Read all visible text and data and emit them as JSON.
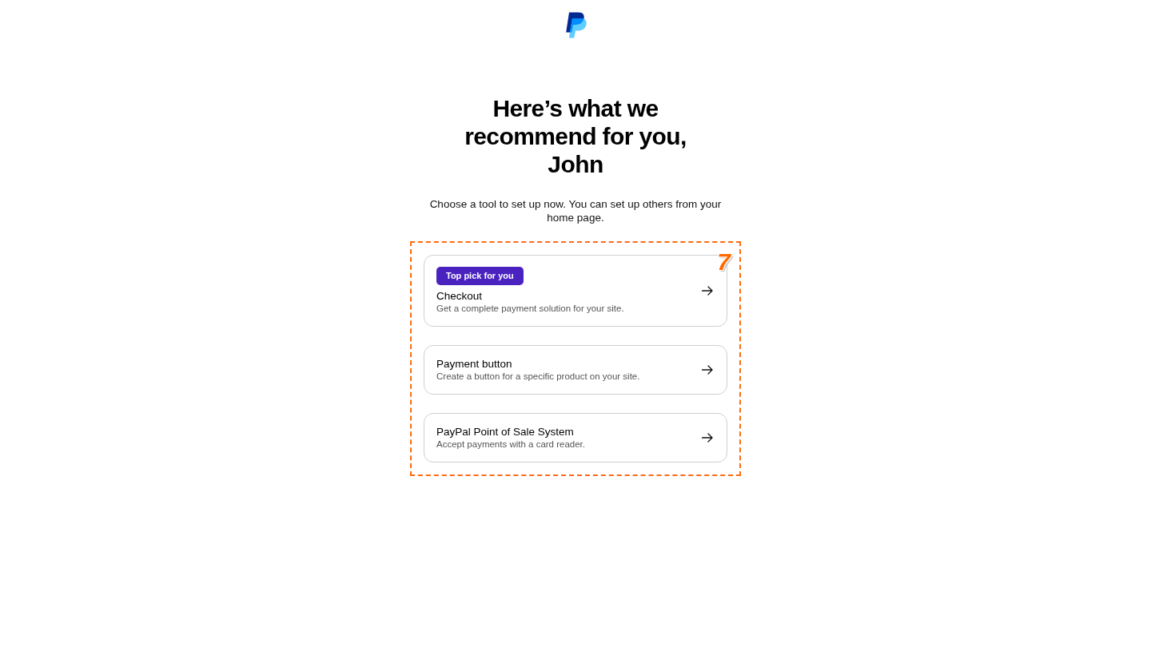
{
  "heading": "Here’s what we recommend for you, John",
  "subtitle": "Choose a tool to set up now. You can set up others from your home page.",
  "annotation": {
    "label": "7"
  },
  "tools": [
    {
      "badge": "Top pick for you",
      "title": "Checkout",
      "description": "Get a complete payment solution for your site."
    },
    {
      "title": "Payment button",
      "description": "Create a button for a specific product on your site."
    },
    {
      "title": "PayPal Point of Sale System",
      "description": "Accept payments with a card reader."
    }
  ]
}
